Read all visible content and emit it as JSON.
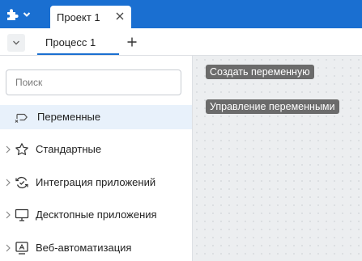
{
  "header": {
    "app_menu_icon": "puzzle-icon",
    "project_tab": {
      "label": "Проект 1",
      "close_icon": "close-icon"
    }
  },
  "process_bar": {
    "collapse_icon": "chevron-down-icon",
    "process_tab": {
      "label": "Процесс 1"
    },
    "add_icon": "plus-icon"
  },
  "sidebar": {
    "search": {
      "placeholder": "Поиск",
      "value": ""
    },
    "items": [
      {
        "label": "Переменные",
        "icon": "variable-icon",
        "expandable": false,
        "active": true
      },
      {
        "label": "Стандартные",
        "icon": "star-icon",
        "expandable": true,
        "active": false
      },
      {
        "label": "Интеграция приложений",
        "icon": "integration-icon",
        "expandable": true,
        "active": false
      },
      {
        "label": "Десктопные приложения",
        "icon": "monitor-icon",
        "expandable": true,
        "active": false
      },
      {
        "label": "Веб-автоматизация",
        "icon": "web-automation-icon",
        "expandable": true,
        "active": false
      }
    ]
  },
  "canvas": {
    "create_variable_label": "Создать переменную",
    "manage_variables_label": "Управление переменными"
  },
  "colors": {
    "accent": "#1a6fd1",
    "active_item_bg": "#e8f1fb",
    "canvas_button_bg": "#6b6b6b"
  }
}
